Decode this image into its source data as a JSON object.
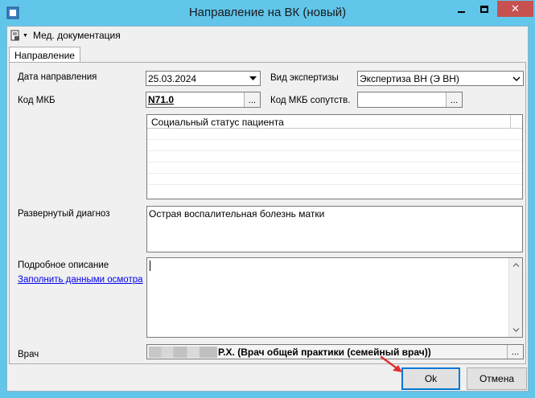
{
  "window": {
    "title": "Направление на ВК (новый)",
    "close_glyph": "✕"
  },
  "toolbar": {
    "menu_label": "Мед. документация",
    "dropdown_glyph": "▼"
  },
  "tabs": [
    {
      "label": "Направление",
      "active": true
    }
  ],
  "form": {
    "date_label": "Дата направления",
    "date_value": "25.03.2024",
    "expertise_label": "Вид экспертизы",
    "expertise_value": "Экспертиза ВН (Э ВН)",
    "mkb_label": "Код МКБ",
    "mkb_value": "N71.0",
    "mkb_related_label": "Код МКБ сопутств.",
    "mkb_related_value": "",
    "ellipsis": "...",
    "social_status_header": "Социальный статус пациента",
    "diagnosis_label": "Развернутый диагноз",
    "diagnosis_value": "Острая воспалительная болезнь матки",
    "description_label": "Подробное описание",
    "fill_link": "Заполнить данными осмотра",
    "description_value": "",
    "doctor_label": "Врач",
    "doctor_value": "Р.Х. (Врач общей практики (семейный врач))"
  },
  "buttons": {
    "ok": "Ok",
    "cancel": "Отмена"
  },
  "colors": {
    "titlebar": "#62c5ea",
    "close_button": "#c75050",
    "annotation_arrow": "#e03030"
  }
}
